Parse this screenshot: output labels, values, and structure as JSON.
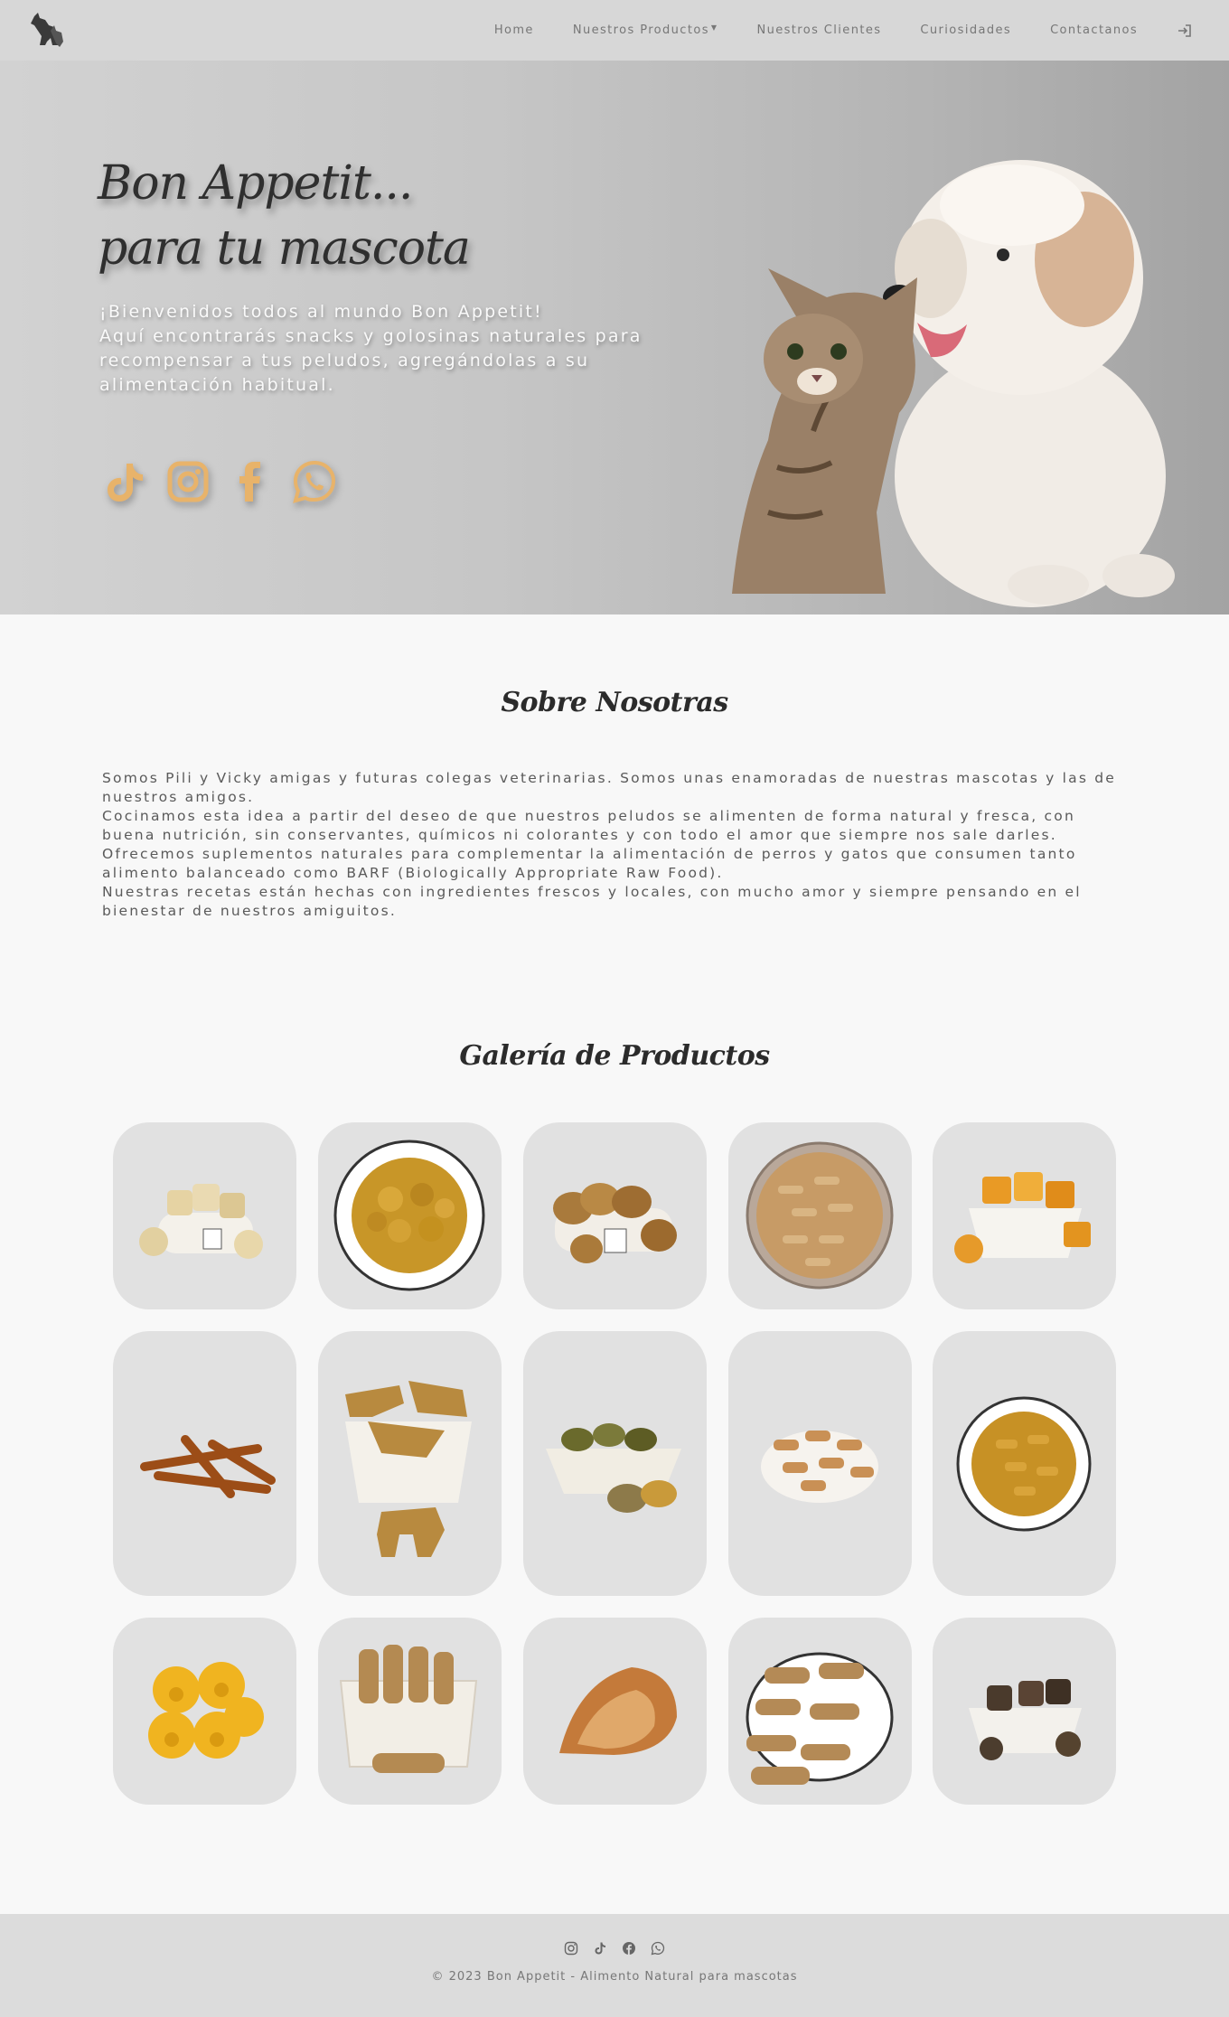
{
  "nav": {
    "logo_alt": "Bon Appetit",
    "links": [
      "Home",
      "Nuestros Productos",
      "Nuestros Clientes",
      "Curiosidades",
      "Contactanos"
    ],
    "login_icon": "sign-in-icon"
  },
  "hero": {
    "title_line1": "Bon Appetit...",
    "title_line2": "para tu mascota",
    "text_line1": "¡Bienvenidos todos al mundo Bon Appetit!",
    "text_line2": "Aquí encontrarás snacks y golosinas naturales para recompensar a tus peludos, agregándolas a su alimentación habitual.",
    "socials": [
      "tiktok-icon",
      "instagram-icon",
      "facebook-icon",
      "whatsapp-icon"
    ],
    "accent_color": "#e8b36a"
  },
  "about": {
    "title": "Sobre Nosotras",
    "paragraphs": [
      "Somos Pili y Vicky amigas y futuras colegas veterinarias. Somos unas enamoradas de nuestras mascotas y las de nuestros amigos.",
      "Cocinamos esta idea a partir del deseo de que nuestros peludos se alimenten de forma natural y fresca, con buena nutrición, sin conservantes, químicos ni colorantes y con todo el amor que siempre nos sale darles.",
      "Ofrecemos suplementos naturales para complementar la alimentación de perros y gatos que consumen tanto alimento balanceado como BARF (Biologically Appropriate Raw Food).",
      "Nuestras recetas están hechas con ingredientes frescos y locales, con mucho amor y siempre pensando en el bienestar de nuestros amiguitos."
    ]
  },
  "gallery": {
    "title": "Galería de Productos"
  },
  "footer": {
    "icons": [
      "instagram-icon",
      "tiktok-icon",
      "facebook-icon",
      "whatsapp-icon"
    ],
    "copyright": "© 2023 Bon Appetit - Alimento Natural para mascotas"
  }
}
